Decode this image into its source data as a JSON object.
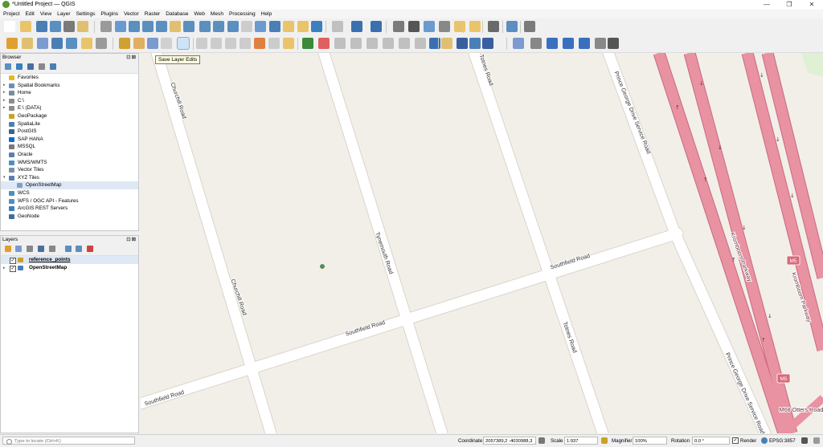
{
  "window": {
    "title": "*Untitled Project — QGIS",
    "controls": [
      "—",
      "❐",
      "✕"
    ]
  },
  "menu": [
    "Project",
    "Edit",
    "View",
    "Layer",
    "Settings",
    "Plugins",
    "Vector",
    "Raster",
    "Database",
    "Web",
    "Mesh",
    "Processing",
    "Help"
  ],
  "tooltip": "Save Layer Edits",
  "browser": {
    "title": "Browser",
    "items": [
      {
        "label": "Favorites",
        "icon": "star-icon",
        "color": "#e8b923",
        "indent": 1,
        "arrow": ""
      },
      {
        "label": "Spatial Bookmarks",
        "icon": "bookmark-icon",
        "color": "#6a8fbf",
        "indent": 1,
        "arrow": "▸"
      },
      {
        "label": "Home",
        "icon": "home-folder-icon",
        "color": "#7a8aa0",
        "indent": 1,
        "arrow": "▸"
      },
      {
        "label": "C:\\",
        "icon": "drive-icon",
        "color": "#8c8c8c",
        "indent": 1,
        "arrow": "▸"
      },
      {
        "label": "E:\\ (DATA)",
        "icon": "drive-icon",
        "color": "#8c8c8c",
        "indent": 1,
        "arrow": "▸"
      },
      {
        "label": "GeoPackage",
        "icon": "geopackage-icon",
        "color": "#c9a227",
        "indent": 1,
        "arrow": ""
      },
      {
        "label": "SpatiaLite",
        "icon": "spatialite-icon",
        "color": "#4a7fb5",
        "indent": 1,
        "arrow": ""
      },
      {
        "label": "PostGIS",
        "icon": "postgis-elephant-icon",
        "color": "#336791",
        "indent": 1,
        "arrow": ""
      },
      {
        "label": "SAP HANA",
        "icon": "sap-hana-icon",
        "color": "#0a6ed1",
        "indent": 1,
        "arrow": ""
      },
      {
        "label": "MSSQL",
        "icon": "mssql-icon",
        "color": "#7a7a7a",
        "indent": 1,
        "arrow": ""
      },
      {
        "label": "Oracle",
        "icon": "oracle-icon",
        "color": "#5a7fa8",
        "indent": 1,
        "arrow": ""
      },
      {
        "label": "WMS/WMTS",
        "icon": "wms-globe-icon",
        "color": "#4f8fc0",
        "indent": 1,
        "arrow": ""
      },
      {
        "label": "Vector Tiles",
        "icon": "vector-tiles-icon",
        "color": "#7f8fa5",
        "indent": 1,
        "arrow": ""
      },
      {
        "label": "XYZ Tiles",
        "icon": "xyz-tiles-grid-icon",
        "color": "#5a7fb0",
        "indent": 1,
        "arrow": "▾"
      },
      {
        "label": "OpenStreetMap",
        "icon": "tile-layer-icon",
        "color": "#7fa0c5",
        "indent": 2,
        "arrow": "",
        "selected": true
      },
      {
        "label": "WCS",
        "icon": "wcs-globe-icon",
        "color": "#4f8fc0",
        "indent": 1,
        "arrow": ""
      },
      {
        "label": "WFS / OGC API - Features",
        "icon": "wfs-globe-icon",
        "color": "#4f8fc0",
        "indent": 1,
        "arrow": ""
      },
      {
        "label": "ArcGIS REST Servers",
        "icon": "arcgis-icon",
        "color": "#3a7fc0",
        "indent": 1,
        "arrow": ""
      },
      {
        "label": "GeoNode",
        "icon": "geonode-icon",
        "color": "#3f6f9f",
        "indent": 1,
        "arrow": ""
      }
    ]
  },
  "layers": {
    "title": "Layers",
    "items": [
      {
        "label": "reference_points",
        "icon": "editing-pencil-icon",
        "checked": true,
        "underline": true,
        "selected": true
      },
      {
        "label": "OpenStreetMap",
        "icon": "raster-layer-icon",
        "checked": true,
        "underline": false,
        "selected": false
      }
    ]
  },
  "map": {
    "roads": [
      "Churchill Road",
      "Churchill Road",
      "Tynemouth Road",
      "Totnes Road",
      "Totnes Road",
      "Prince George Drive Service Road",
      "Prince George Drive Service Road",
      "Southfield Road",
      "Southfield Road",
      "Southfield Road",
      "Kromboom Parkway",
      "Kromboom Parkway",
      "M68 Otters Road"
    ],
    "shields": [
      "M5",
      "M5"
    ],
    "colors": {
      "background": "#f2efe9",
      "road": "#ffffff",
      "road_casing": "#d9d4cc",
      "motorway": "#e892a2",
      "motorway_casing": "#c86a80",
      "point": "#5a8f5a",
      "park": "#dff0d5"
    }
  },
  "status": {
    "locator_placeholder": "Type to locate (Ctrl+K)",
    "coordinate_label": "Coordinate",
    "coordinate": "2057389,2 -4030988,3",
    "scale_label": "Scale",
    "scale": "1:937",
    "magnifier_label": "Magnifier",
    "magnifier": "100%",
    "rotation_label": "Rotation",
    "rotation": "0,0 °",
    "render_label": "Render",
    "crs": "EPSG:3857"
  }
}
